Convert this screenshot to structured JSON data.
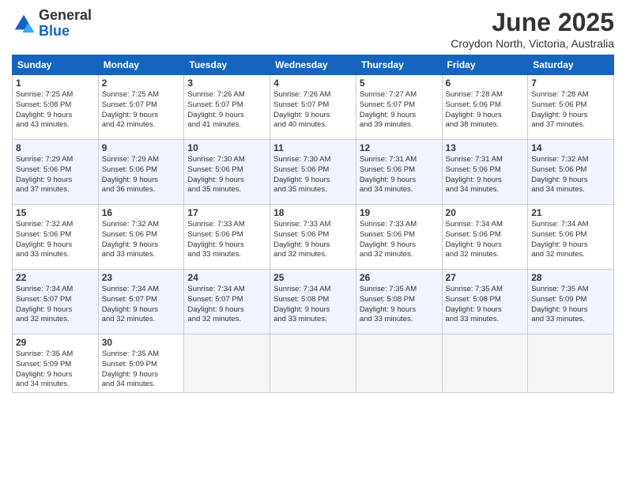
{
  "logo": {
    "general": "General",
    "blue": "Blue"
  },
  "title": "June 2025",
  "subtitle": "Croydon North, Victoria, Australia",
  "headers": [
    "Sunday",
    "Monday",
    "Tuesday",
    "Wednesday",
    "Thursday",
    "Friday",
    "Saturday"
  ],
  "rows": [
    [
      {
        "day": "1",
        "info": "Sunrise: 7:25 AM\nSunset: 5:08 PM\nDaylight: 9 hours\nand 43 minutes."
      },
      {
        "day": "2",
        "info": "Sunrise: 7:25 AM\nSunset: 5:07 PM\nDaylight: 9 hours\nand 42 minutes."
      },
      {
        "day": "3",
        "info": "Sunrise: 7:26 AM\nSunset: 5:07 PM\nDaylight: 9 hours\nand 41 minutes."
      },
      {
        "day": "4",
        "info": "Sunrise: 7:26 AM\nSunset: 5:07 PM\nDaylight: 9 hours\nand 40 minutes."
      },
      {
        "day": "5",
        "info": "Sunrise: 7:27 AM\nSunset: 5:07 PM\nDaylight: 9 hours\nand 39 minutes."
      },
      {
        "day": "6",
        "info": "Sunrise: 7:28 AM\nSunset: 5:06 PM\nDaylight: 9 hours\nand 38 minutes."
      },
      {
        "day": "7",
        "info": "Sunrise: 7:28 AM\nSunset: 5:06 PM\nDaylight: 9 hours\nand 37 minutes."
      }
    ],
    [
      {
        "day": "8",
        "info": "Sunrise: 7:29 AM\nSunset: 5:06 PM\nDaylight: 9 hours\nand 37 minutes."
      },
      {
        "day": "9",
        "info": "Sunrise: 7:29 AM\nSunset: 5:06 PM\nDaylight: 9 hours\nand 36 minutes."
      },
      {
        "day": "10",
        "info": "Sunrise: 7:30 AM\nSunset: 5:06 PM\nDaylight: 9 hours\nand 35 minutes."
      },
      {
        "day": "11",
        "info": "Sunrise: 7:30 AM\nSunset: 5:06 PM\nDaylight: 9 hours\nand 35 minutes."
      },
      {
        "day": "12",
        "info": "Sunrise: 7:31 AM\nSunset: 5:06 PM\nDaylight: 9 hours\nand 34 minutes."
      },
      {
        "day": "13",
        "info": "Sunrise: 7:31 AM\nSunset: 5:06 PM\nDaylight: 9 hours\nand 34 minutes."
      },
      {
        "day": "14",
        "info": "Sunrise: 7:32 AM\nSunset: 5:06 PM\nDaylight: 9 hours\nand 34 minutes."
      }
    ],
    [
      {
        "day": "15",
        "info": "Sunrise: 7:32 AM\nSunset: 5:06 PM\nDaylight: 9 hours\nand 33 minutes."
      },
      {
        "day": "16",
        "info": "Sunrise: 7:32 AM\nSunset: 5:06 PM\nDaylight: 9 hours\nand 33 minutes."
      },
      {
        "day": "17",
        "info": "Sunrise: 7:33 AM\nSunset: 5:06 PM\nDaylight: 9 hours\nand 33 minutes."
      },
      {
        "day": "18",
        "info": "Sunrise: 7:33 AM\nSunset: 5:06 PM\nDaylight: 9 hours\nand 32 minutes."
      },
      {
        "day": "19",
        "info": "Sunrise: 7:33 AM\nSunset: 5:06 PM\nDaylight: 9 hours\nand 32 minutes."
      },
      {
        "day": "20",
        "info": "Sunrise: 7:34 AM\nSunset: 5:06 PM\nDaylight: 9 hours\nand 32 minutes."
      },
      {
        "day": "21",
        "info": "Sunrise: 7:34 AM\nSunset: 5:06 PM\nDaylight: 9 hours\nand 32 minutes."
      }
    ],
    [
      {
        "day": "22",
        "info": "Sunrise: 7:34 AM\nSunset: 5:07 PM\nDaylight: 9 hours\nand 32 minutes."
      },
      {
        "day": "23",
        "info": "Sunrise: 7:34 AM\nSunset: 5:07 PM\nDaylight: 9 hours\nand 32 minutes."
      },
      {
        "day": "24",
        "info": "Sunrise: 7:34 AM\nSunset: 5:07 PM\nDaylight: 9 hours\nand 32 minutes."
      },
      {
        "day": "25",
        "info": "Sunrise: 7:34 AM\nSunset: 5:08 PM\nDaylight: 9 hours\nand 33 minutes."
      },
      {
        "day": "26",
        "info": "Sunrise: 7:35 AM\nSunset: 5:08 PM\nDaylight: 9 hours\nand 33 minutes."
      },
      {
        "day": "27",
        "info": "Sunrise: 7:35 AM\nSunset: 5:08 PM\nDaylight: 9 hours\nand 33 minutes."
      },
      {
        "day": "28",
        "info": "Sunrise: 7:35 AM\nSunset: 5:09 PM\nDaylight: 9 hours\nand 33 minutes."
      }
    ],
    [
      {
        "day": "29",
        "info": "Sunrise: 7:35 AM\nSunset: 5:09 PM\nDaylight: 9 hours\nand 34 minutes."
      },
      {
        "day": "30",
        "info": "Sunrise: 7:35 AM\nSunset: 5:09 PM\nDaylight: 9 hours\nand 34 minutes."
      },
      {
        "day": "",
        "info": ""
      },
      {
        "day": "",
        "info": ""
      },
      {
        "day": "",
        "info": ""
      },
      {
        "day": "",
        "info": ""
      },
      {
        "day": "",
        "info": ""
      }
    ]
  ]
}
